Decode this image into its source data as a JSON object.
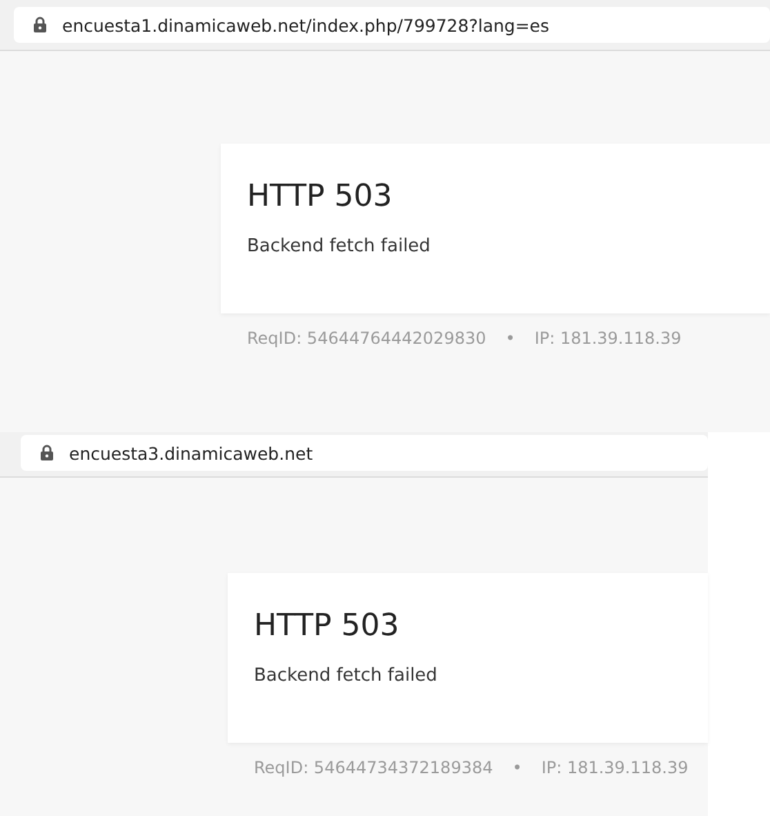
{
  "screenshots": [
    {
      "url": "encuesta1.dinamicaweb.net/index.php/799728?lang=es",
      "title": "HTTP 503",
      "message": "Backend fetch failed",
      "req_id": "ReqID: 54644764442029830",
      "separator": "•",
      "ip": "IP: 181.39.118.39"
    },
    {
      "url": "encuesta3.dinamicaweb.net",
      "title": "HTTP 503",
      "message": "Backend fetch failed",
      "req_id": "ReqID: 54644734372189384",
      "separator": "•",
      "ip": "IP: 181.39.118.39"
    }
  ]
}
